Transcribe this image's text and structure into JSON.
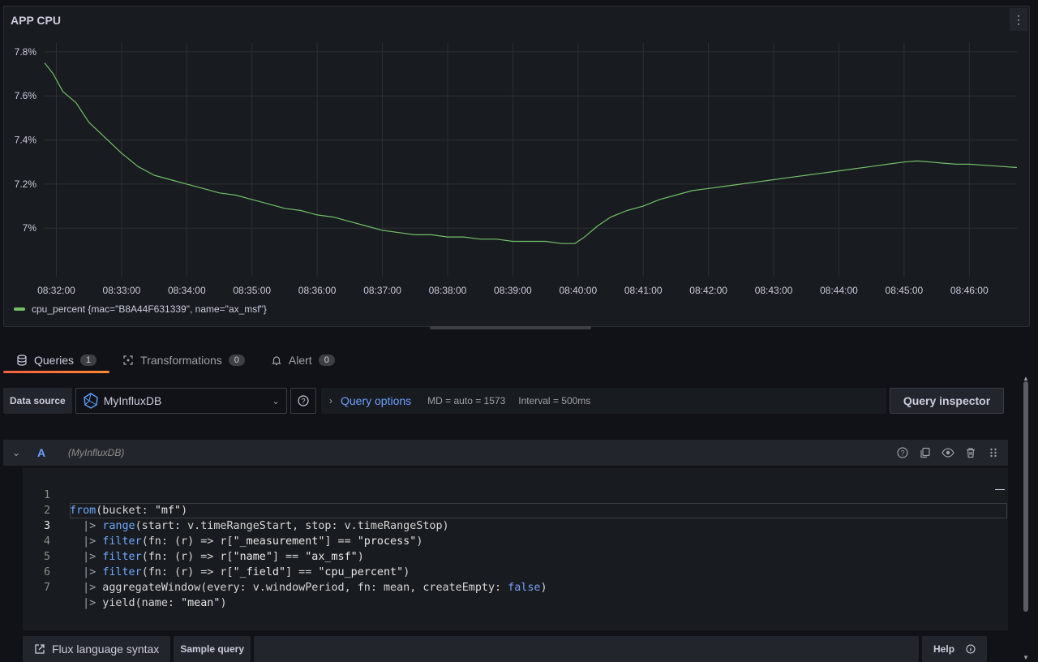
{
  "panel": {
    "title": "APP CPU",
    "menu_icon": "vertical-dots-icon"
  },
  "chart_data": {
    "type": "line",
    "title": "APP CPU",
    "ylabel": "",
    "xlabel": "",
    "y_ticks": [
      "7.8%",
      "7.6%",
      "7.4%",
      "7.2%",
      "7%"
    ],
    "y_tick_values": [
      7.8,
      7.6,
      7.4,
      7.2,
      7.0
    ],
    "ylim": [
      6.78,
      7.84
    ],
    "x_ticks": [
      "08:32:00",
      "08:33:00",
      "08:34:00",
      "08:35:00",
      "08:36:00",
      "08:37:00",
      "08:38:00",
      "08:39:00",
      "08:40:00",
      "08:41:00",
      "08:42:00",
      "08:43:00",
      "08:44:00",
      "08:45:00",
      "08:46:00"
    ],
    "x_range_minutes": [
      31.82,
      46.73
    ],
    "grid": true,
    "legend_position": "bottom-left",
    "series": [
      {
        "name": "cpu_percent {mac=\"B8A44F631339\", name=\"ax_msf\"}",
        "color": "#73bf69",
        "x_minutes": [
          31.82,
          31.95,
          32.1,
          32.3,
          32.5,
          32.75,
          33.0,
          33.25,
          33.5,
          33.75,
          34.0,
          34.25,
          34.5,
          34.75,
          35.0,
          35.25,
          35.5,
          35.75,
          36.0,
          36.25,
          36.5,
          36.75,
          37.0,
          37.25,
          37.5,
          37.75,
          38.0,
          38.25,
          38.5,
          38.75,
          39.0,
          39.25,
          39.5,
          39.75,
          39.95,
          40.1,
          40.3,
          40.5,
          40.75,
          41.0,
          41.25,
          41.5,
          41.75,
          42.0,
          42.25,
          42.5,
          42.75,
          43.0,
          43.25,
          43.5,
          43.75,
          44.0,
          44.25,
          44.5,
          44.75,
          45.0,
          45.2,
          45.4,
          45.6,
          45.8,
          46.0,
          46.25,
          46.5,
          46.73
        ],
        "y": [
          7.75,
          7.7,
          7.62,
          7.57,
          7.48,
          7.41,
          7.34,
          7.28,
          7.24,
          7.22,
          7.2,
          7.18,
          7.16,
          7.15,
          7.13,
          7.11,
          7.09,
          7.08,
          7.06,
          7.05,
          7.03,
          7.01,
          6.99,
          6.98,
          6.97,
          6.97,
          6.96,
          6.96,
          6.95,
          6.95,
          6.94,
          6.94,
          6.94,
          6.93,
          6.93,
          6.96,
          7.01,
          7.05,
          7.08,
          7.1,
          7.13,
          7.15,
          7.17,
          7.18,
          7.19,
          7.2,
          7.21,
          7.22,
          7.23,
          7.24,
          7.25,
          7.26,
          7.27,
          7.28,
          7.29,
          7.3,
          7.305,
          7.3,
          7.295,
          7.29,
          7.29,
          7.285,
          7.28,
          7.275
        ]
      }
    ]
  },
  "tabs": [
    {
      "label": "Queries",
      "count": "1",
      "icon": "database-icon",
      "active": true
    },
    {
      "label": "Transformations",
      "count": "0",
      "icon": "transform-icon",
      "active": false
    },
    {
      "label": "Alert",
      "count": "0",
      "icon": "bell-icon",
      "active": false
    }
  ],
  "datasource": {
    "label": "Data source",
    "selected": "MyInfluxDB",
    "icon": "influxdb-icon"
  },
  "query_options": {
    "label": "Query options",
    "md": "MD = auto = 1573",
    "interval": "Interval = 500ms"
  },
  "query_inspector_label": "Query inspector",
  "query_row": {
    "ref_id": "A",
    "datasource_name": "(MyInfluxDB)"
  },
  "code": {
    "line_numbers": [
      "1",
      "2",
      "3",
      "4",
      "5",
      "6",
      "7"
    ],
    "lines": [
      "from(bucket: \"mf\")",
      "  |> range(start: v.timeRangeStart, stop: v.timeRangeStop)",
      "  |> filter(fn: (r) => r[\"_measurement\"] == \"process\")",
      "  |> filter(fn: (r) => r[\"name\"] == \"ax_msf\")",
      "  |> filter(fn: (r) => r[\"_field\"] == \"cpu_percent\")",
      "  |> aggregateWindow(every: v.windowPeriod, fn: mean, createEmpty: false)",
      "  |> yield(name: \"mean\")"
    ]
  },
  "footer": {
    "flux_syntax": "Flux language syntax",
    "sample_query": "Sample query",
    "help": "Help"
  }
}
